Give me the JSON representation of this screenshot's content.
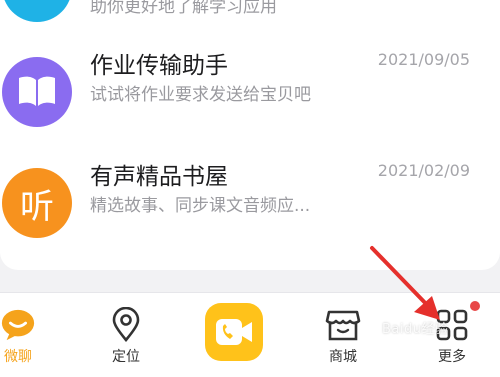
{
  "conversations": [
    {
      "title": "",
      "subtitle": "助你更好地了解学习应用",
      "date": "",
      "icon": "check-icon",
      "color": "#1fb2e6"
    },
    {
      "title": "作业传输助手",
      "subtitle": "试试将作业要求发送给宝贝吧",
      "date": "2021/09/05",
      "icon": "book-icon",
      "color": "#8a6cf0"
    },
    {
      "title": "有声精品书屋",
      "subtitle": "精选故事、同步课文音频应...",
      "date": "2021/02/09",
      "icon": "listen-icon",
      "icon_glyph": "听",
      "color": "#f7921e"
    }
  ],
  "nav": {
    "items": [
      {
        "label": "微聊",
        "icon": "chat-bubble-icon",
        "active": true
      },
      {
        "label": "定位",
        "icon": "location-pin-icon",
        "active": false
      },
      {
        "label": "",
        "icon": "video-call-icon",
        "active": false
      },
      {
        "label": "商城",
        "icon": "shop-icon",
        "active": false
      },
      {
        "label": "更多",
        "icon": "grid-icon",
        "active": false,
        "badge_dot": true
      }
    ]
  },
  "colors": {
    "accent": "#f5a31b",
    "badge": "#e84848",
    "arrow": "#e5302c"
  },
  "watermark": "Baidu经验"
}
